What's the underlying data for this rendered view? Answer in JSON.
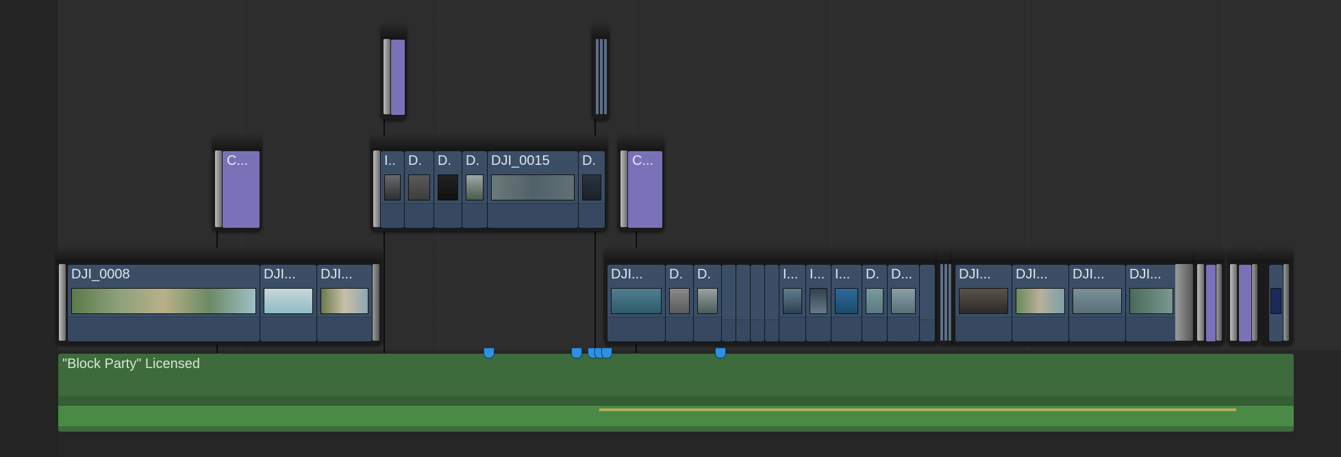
{
  "timeline": {
    "audio_clip_name": "\"Block Party\" Licensed",
    "primary_group_1": {
      "clips": [
        "DJI_0008",
        "DJI...",
        "DJI..."
      ]
    },
    "connected_group_1": {
      "clips": [
        "I..",
        "D.",
        "D.",
        "D.",
        "DJI_0015",
        "D."
      ]
    },
    "connected_title_1": "C...",
    "connected_title_2": "C...",
    "primary_group_2": {
      "clips": [
        "DJI...",
        "D.",
        "D.",
        "I...",
        "I...",
        "I...",
        "D.",
        "D..."
      ]
    },
    "primary_group_3": {
      "clips": [
        "DJI...",
        "DJI...",
        "DJI...",
        "DJI..."
      ]
    }
  },
  "colors": {
    "video_clip": "#3b4e66",
    "title_clip": "#7a72b8",
    "audio_clip": "#3d6b3c",
    "marker": "#2f8fe0"
  }
}
